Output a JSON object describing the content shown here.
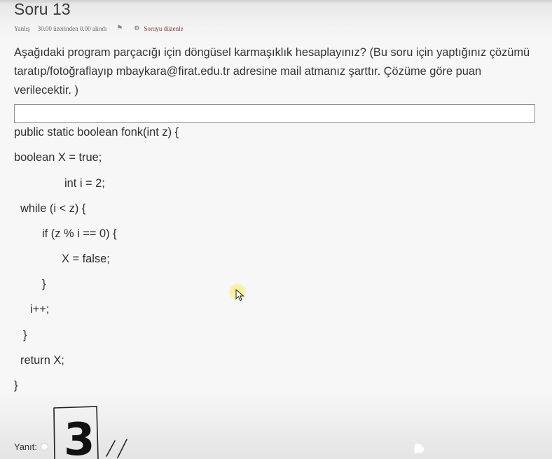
{
  "question": {
    "title": "Soru 13",
    "status": "Yanlış",
    "score": "30.00 üzerinden 0.00 alındı",
    "edit_label": "Soruyu düzenle",
    "text": "Aşağıdaki program parçacığı için döngüsel karmaşıklık hesaplayınız? (Bu soru için yaptığınız çözümü taratıp/fotoğraflayıp mbaykara@firat.edu.tr adresine mail atmanız şarttır. Çözüme göre puan verilecektir. )"
  },
  "code_lines": [
    "public static boolean fonk(int z) {",
    "boolean X = true;",
    "int i = 2;",
    "while (i < z) {",
    "if (z % i == 0) {",
    "X = false;",
    "}",
    "i++;",
    "}",
    "return X;",
    "}"
  ],
  "answer": {
    "label": "Yanıt:",
    "handwritten_value": "3"
  },
  "icons": {
    "flag": "flag-icon",
    "edit": "gear-icon",
    "cursor": "mouse-pointer-icon"
  },
  "colors": {
    "background": "#f3f3f3",
    "text": "#333333",
    "edit_link": "#7a3b3b",
    "cursor_highlight": "#faec78"
  }
}
